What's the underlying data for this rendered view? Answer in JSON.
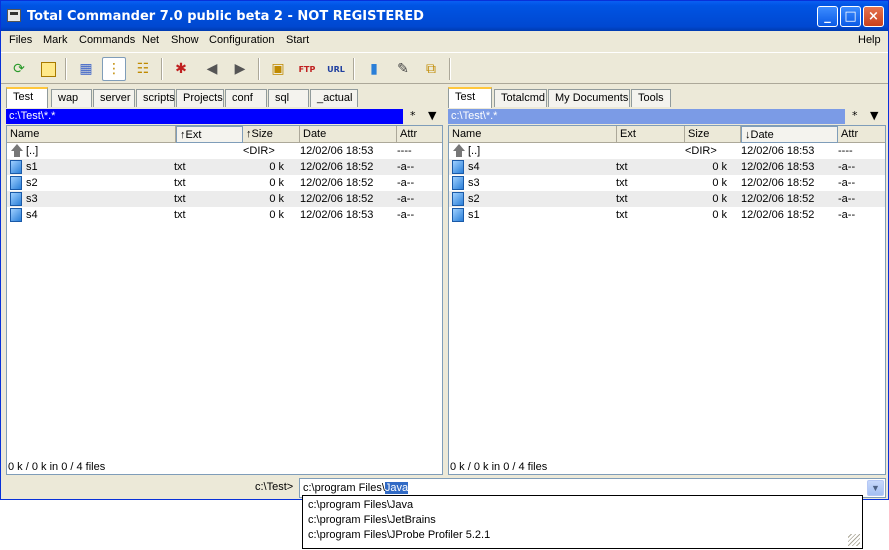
{
  "window": {
    "title": "Total Commander 7.0 public beta 2 - NOT REGISTERED"
  },
  "title_buttons": {
    "minimize": "_",
    "maximize": "□",
    "close": "×"
  },
  "menu": {
    "items": [
      "Files",
      "Mark",
      "Commands",
      "Net",
      "Show",
      "Configuration",
      "Start"
    ],
    "help": "Help"
  },
  "toolbar": {
    "icons": [
      "refresh-icon",
      "tree-icon",
      "icon-view-icon",
      "brief-view-icon",
      "full-view-icon",
      "select-icon",
      "back-icon",
      "forward-icon",
      "pack-icon",
      "ftp-icon",
      "url-icon",
      "notepad-icon",
      "edit-icon",
      "compare-icon"
    ]
  },
  "left": {
    "tabs": [
      "Test",
      "wap",
      "server",
      "scripts",
      "Projects",
      "conf",
      "sql",
      "_actual"
    ],
    "path": "c:\\Test\\*.*",
    "filter_btn": "*",
    "history_btn": "▼",
    "columns": {
      "name": "Name",
      "ext": "↑Ext",
      "size": "↑Size",
      "date": "Date",
      "attr": "Attr"
    },
    "rows": [
      {
        "name": "[..]",
        "ext": "",
        "size": "<DIR>",
        "date": "12/02/06 18:53",
        "attr": "----"
      },
      {
        "name": "s1",
        "ext": "txt",
        "size": "0 k",
        "date": "12/02/06 18:52",
        "attr": "-a--"
      },
      {
        "name": "s2",
        "ext": "txt",
        "size": "0 k",
        "date": "12/02/06 18:52",
        "attr": "-a--"
      },
      {
        "name": "s3",
        "ext": "txt",
        "size": "0 k",
        "date": "12/02/06 18:52",
        "attr": "-a--"
      },
      {
        "name": "s4",
        "ext": "txt",
        "size": "0 k",
        "date": "12/02/06 18:53",
        "attr": "-a--"
      }
    ],
    "status": "0 k / 0 k in 0 / 4 files"
  },
  "right": {
    "tabs": [
      "Test",
      "Totalcmd",
      "My Documents",
      "Tools"
    ],
    "path": "c:\\Test\\*.*",
    "filter_btn": "*",
    "history_btn": "▼",
    "columns": {
      "name": "Name",
      "ext": "Ext",
      "size": "Size",
      "date": "↓Date",
      "attr": "Attr"
    },
    "rows": [
      {
        "name": "[..]",
        "ext": "",
        "size": "<DIR>",
        "date": "12/02/06 18:53",
        "attr": "----"
      },
      {
        "name": "s4",
        "ext": "txt",
        "size": "0 k",
        "date": "12/02/06 18:53",
        "attr": "-a--"
      },
      {
        "name": "s3",
        "ext": "txt",
        "size": "0 k",
        "date": "12/02/06 18:52",
        "attr": "-a--"
      },
      {
        "name": "s2",
        "ext": "txt",
        "size": "0 k",
        "date": "12/02/06 18:52",
        "attr": "-a--"
      },
      {
        "name": "s1",
        "ext": "txt",
        "size": "0 k",
        "date": "12/02/06 18:52",
        "attr": "-a--"
      }
    ],
    "status": "0 k / 0 k in 0 / 4 files"
  },
  "command": {
    "label": "c:\\Test>",
    "value_prefix": "c:\\program Files\\",
    "value_selected": "Java",
    "suggestions": [
      "c:\\program Files\\Java",
      "c:\\program Files\\JetBrains",
      "c:\\program Files\\JProbe Profiler 5.2.1"
    ]
  },
  "colors": {
    "active_path": "#0000ff",
    "inactive_path": "#7b9be6",
    "title_bar": "#0054e3"
  }
}
